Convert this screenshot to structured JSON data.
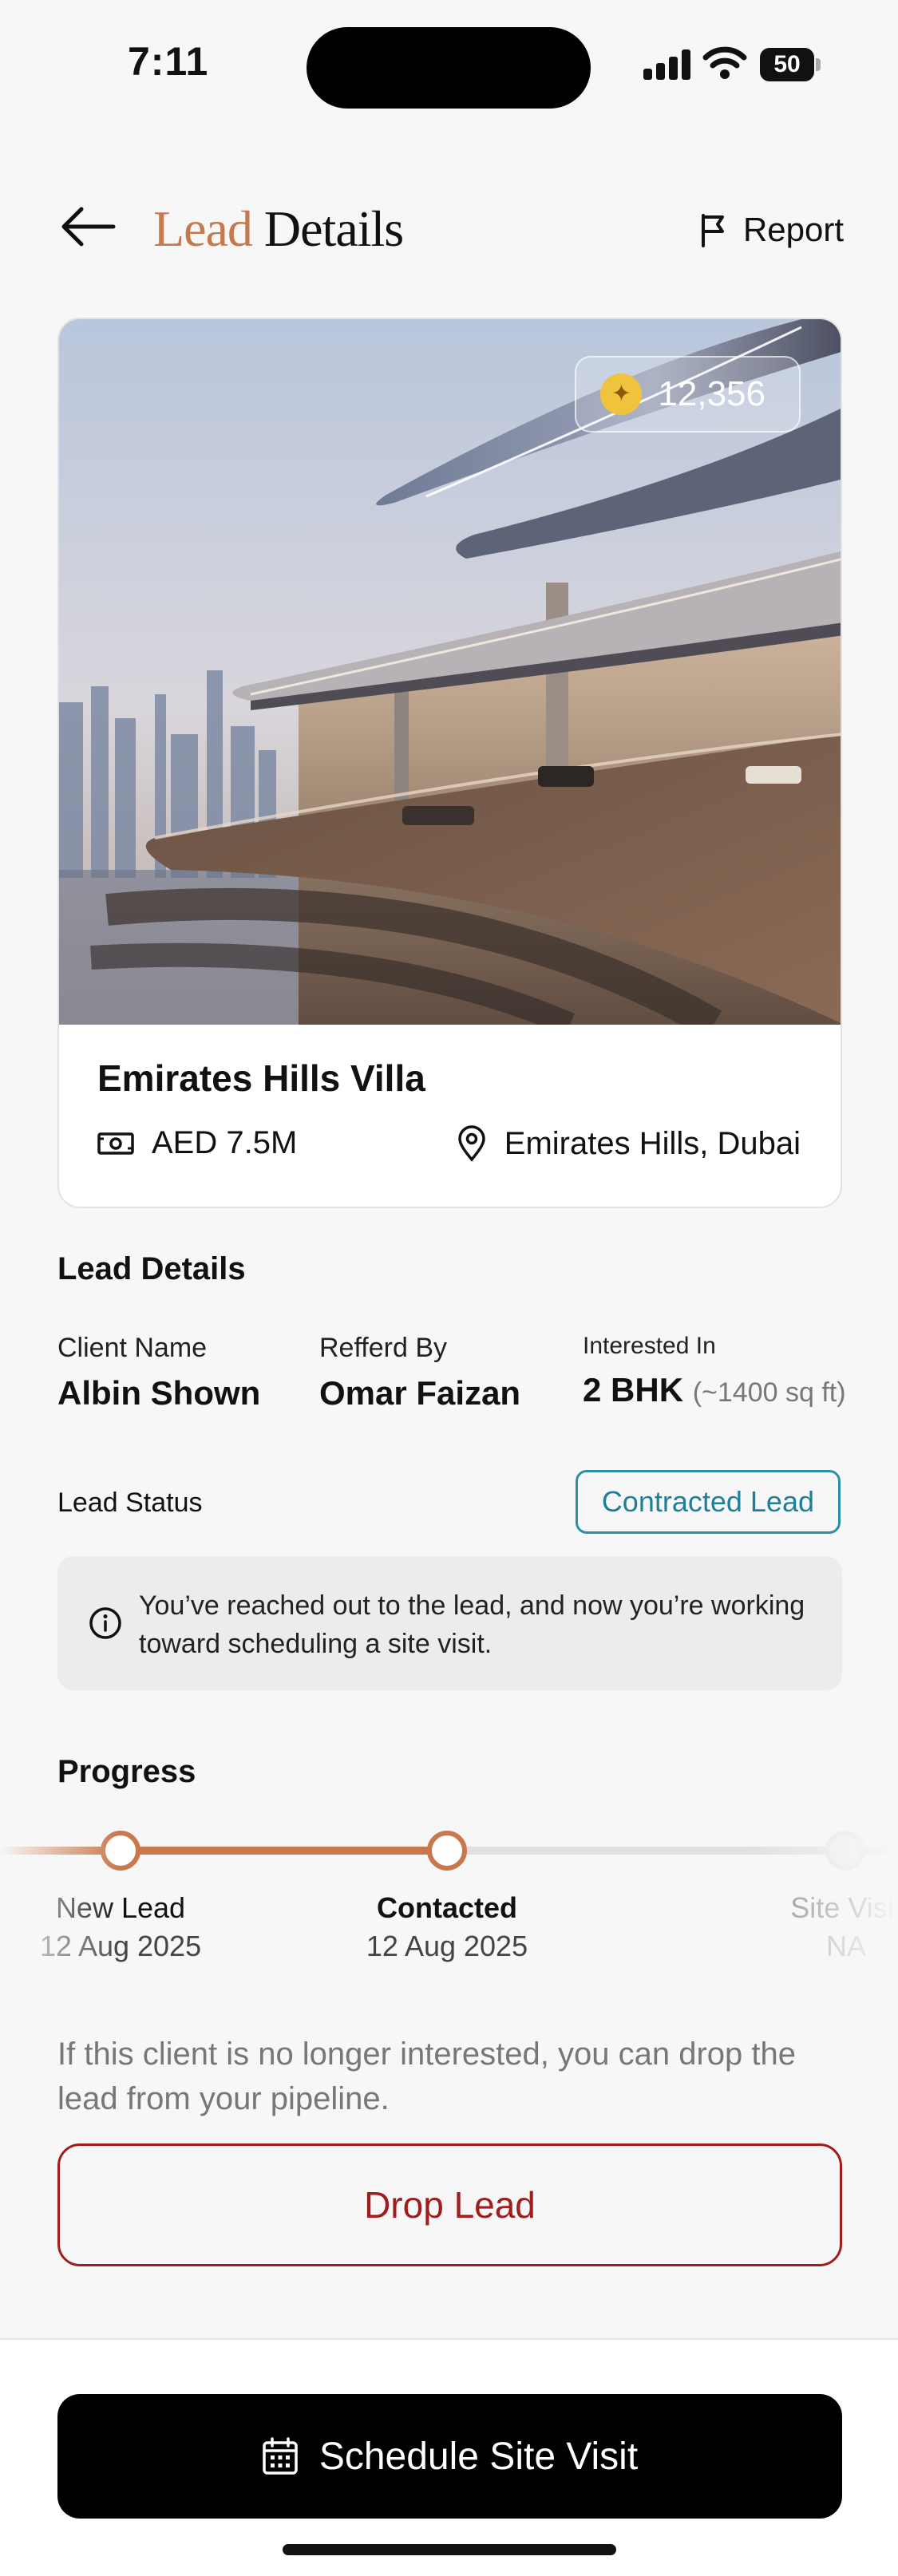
{
  "status_bar": {
    "time": "7:11",
    "battery": "50"
  },
  "header": {
    "title_accent": "Lead",
    "title_rest": "Details",
    "report_label": "Report"
  },
  "property": {
    "coins": "12,356",
    "name": "Emirates Hills Villa",
    "price": "AED 7.5M",
    "location": "Emirates Hills, Dubai"
  },
  "lead_details": {
    "section_title": "Lead Details",
    "client_label": "Client Name",
    "client_value": "Albin Shown",
    "referred_label": "Refferd By",
    "referred_value": "Omar Faizan",
    "interested_label": "Interested In",
    "interested_value": "2 BHK",
    "interested_sub": "(~1400 sq ft)"
  },
  "lead_status": {
    "label": "Lead Status",
    "badge": "Contracted Lead",
    "info": "You’ve reached out to the lead, and now you’re working toward scheduling a site visit.",
    "badge_color": "#2c8fa6"
  },
  "progress": {
    "title": "Progress",
    "steps": [
      {
        "label": "New Lead",
        "date": "12 Aug 2025"
      },
      {
        "label": "Contacted",
        "date": "12 Aug 2025"
      },
      {
        "label": "Site Visit",
        "date": "NA"
      }
    ],
    "accent_color": "#c8784c"
  },
  "drop": {
    "note": "If this client is no longer interested, you can drop the lead from your pipeline.",
    "button": "Drop Lead",
    "color": "#a11d1d"
  },
  "footer": {
    "schedule_button": "Schedule Site Visit"
  }
}
